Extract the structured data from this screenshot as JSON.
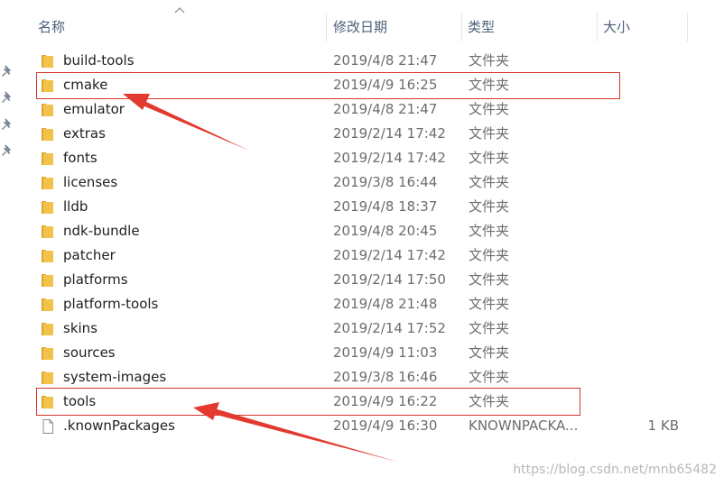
{
  "header": {
    "name_label": "名称",
    "date_label": "修改日期",
    "type_label": "类型",
    "size_label": "大小"
  },
  "colors": {
    "folder": "#f2c24a",
    "folder_dark": "#dca731",
    "highlight": "#d9342b",
    "header_text": "#4c607a",
    "secondary_text": "#6d6d6d"
  },
  "icons": {
    "folder": "folder-icon",
    "file": "file-icon",
    "pin": "pin-icon",
    "sort": "sort-ascending-icon"
  },
  "files": [
    {
      "name": "build-tools",
      "date": "2019/4/8 21:47",
      "type": "文件夹",
      "size": "",
      "kind": "folder"
    },
    {
      "name": "cmake",
      "date": "2019/4/9 16:25",
      "type": "文件夹",
      "size": "",
      "kind": "folder"
    },
    {
      "name": "emulator",
      "date": "2019/4/8 21:47",
      "type": "文件夹",
      "size": "",
      "kind": "folder"
    },
    {
      "name": "extras",
      "date": "2019/2/14 17:42",
      "type": "文件夹",
      "size": "",
      "kind": "folder"
    },
    {
      "name": "fonts",
      "date": "2019/2/14 17:42",
      "type": "文件夹",
      "size": "",
      "kind": "folder"
    },
    {
      "name": "licenses",
      "date": "2019/3/8 16:44",
      "type": "文件夹",
      "size": "",
      "kind": "folder"
    },
    {
      "name": "lldb",
      "date": "2019/4/8 18:37",
      "type": "文件夹",
      "size": "",
      "kind": "folder"
    },
    {
      "name": "ndk-bundle",
      "date": "2019/4/8 20:45",
      "type": "文件夹",
      "size": "",
      "kind": "folder"
    },
    {
      "name": "patcher",
      "date": "2019/2/14 17:42",
      "type": "文件夹",
      "size": "",
      "kind": "folder"
    },
    {
      "name": "platforms",
      "date": "2019/2/14 17:50",
      "type": "文件夹",
      "size": "",
      "kind": "folder"
    },
    {
      "name": "platform-tools",
      "date": "2019/4/8 21:48",
      "type": "文件夹",
      "size": "",
      "kind": "folder"
    },
    {
      "name": "skins",
      "date": "2019/2/14 17:52",
      "type": "文件夹",
      "size": "",
      "kind": "folder"
    },
    {
      "name": "sources",
      "date": "2019/4/9 11:03",
      "type": "文件夹",
      "size": "",
      "kind": "folder"
    },
    {
      "name": "system-images",
      "date": "2019/3/8 16:46",
      "type": "文件夹",
      "size": "",
      "kind": "folder"
    },
    {
      "name": "tools",
      "date": "2019/4/9 16:22",
      "type": "文件夹",
      "size": "",
      "kind": "folder"
    },
    {
      "name": ".knownPackages",
      "date": "2019/4/9 16:30",
      "type": "KNOWNPACKA...",
      "size": "1 KB",
      "kind": "file"
    }
  ],
  "watermark": "https://blog.csdn.net/mnb65482"
}
